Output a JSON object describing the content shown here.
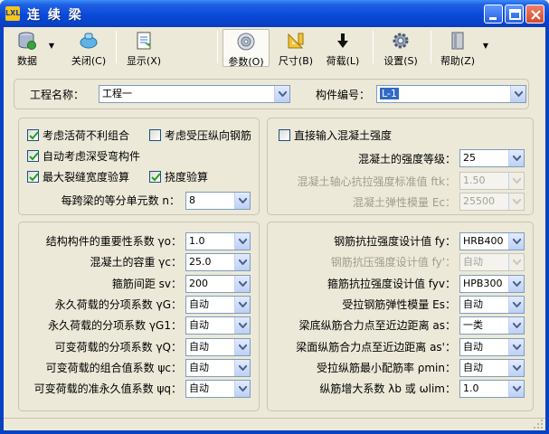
{
  "window": {
    "title": "连 续 梁",
    "icon_text": "LXL"
  },
  "toolbar": {
    "data": "数据",
    "close": "关闭(C)",
    "display": "显示(X)",
    "params": "参数(O)",
    "size": "尺寸(B)",
    "load": "荷载(L)",
    "settings": "设置(S)",
    "help": "帮助(Z)"
  },
  "header": {
    "project_label": "工程名称：",
    "project_value": "工程一",
    "member_label": "构件编号：",
    "member_value": "L-1"
  },
  "options": {
    "chk_live_load": {
      "label": "考虑活荷不利组合",
      "checked": true
    },
    "chk_compression_rebar": {
      "label": "考虑受压纵向钢筋",
      "checked": false
    },
    "chk_deep_beam": {
      "label": "自动考虑深受弯构件",
      "checked": true
    },
    "chk_crack_width": {
      "label": "最大裂缝宽度验算",
      "checked": true
    },
    "chk_deflection": {
      "label": "挠度验算",
      "checked": true
    },
    "units_label": "每跨梁的等分单元数 n：",
    "units_value": "8"
  },
  "concrete": {
    "chk_direct": {
      "label": "直接输入混凝土强度",
      "checked": false
    },
    "grade_label": "混凝土的强度等级：",
    "grade_value": "25",
    "ftk_label": "混凝土轴心抗拉强度标准值 ftk：",
    "ftk_value": "1.50",
    "ec_label": "混凝土弹性模量 Ec：",
    "ec_value": "25500"
  },
  "left_params": [
    {
      "label": "结构构件的重要性系数 γo：",
      "value": "1.0"
    },
    {
      "label": "混凝土的容重 γc：",
      "value": "25.0"
    },
    {
      "label": "箍筋间距 sv：",
      "value": "200"
    },
    {
      "label": "永久荷载的分项系数 γG：",
      "value": "自动"
    },
    {
      "label": "永久荷载的分项系数 γG1：",
      "value": "自动"
    },
    {
      "label": "可变荷载的分项系数 γQ：",
      "value": "自动"
    },
    {
      "label": "可变荷载的组合值系数 ψc：",
      "value": "自动"
    },
    {
      "label": "可变荷载的准永久值系数 ψq：",
      "value": "自动"
    }
  ],
  "right_params": [
    {
      "label": "钢筋抗拉强度设计值 fy：",
      "value": "HRB400",
      "disabled": false
    },
    {
      "label": "钢筋抗压强度设计值 fy'：",
      "value": "自动",
      "disabled": true
    },
    {
      "label": "箍筋抗拉强度设计值 fyv：",
      "value": "HPB300",
      "disabled": false
    },
    {
      "label": "受拉钢筋弹性模量 Es：",
      "value": "自动",
      "disabled": false
    },
    {
      "label": "梁底纵筋合力点至近边距离 as：",
      "value": "一类",
      "disabled": false
    },
    {
      "label": "梁面纵筋合力点至近边距离 as'：",
      "value": "自动",
      "disabled": false
    },
    {
      "label": "受拉纵筋最小配筋率 ρmin：",
      "value": "自动",
      "disabled": false
    },
    {
      "label": "纵筋增大系数 λb 或 ωlim：",
      "value": "1.0",
      "disabled": false
    }
  ]
}
